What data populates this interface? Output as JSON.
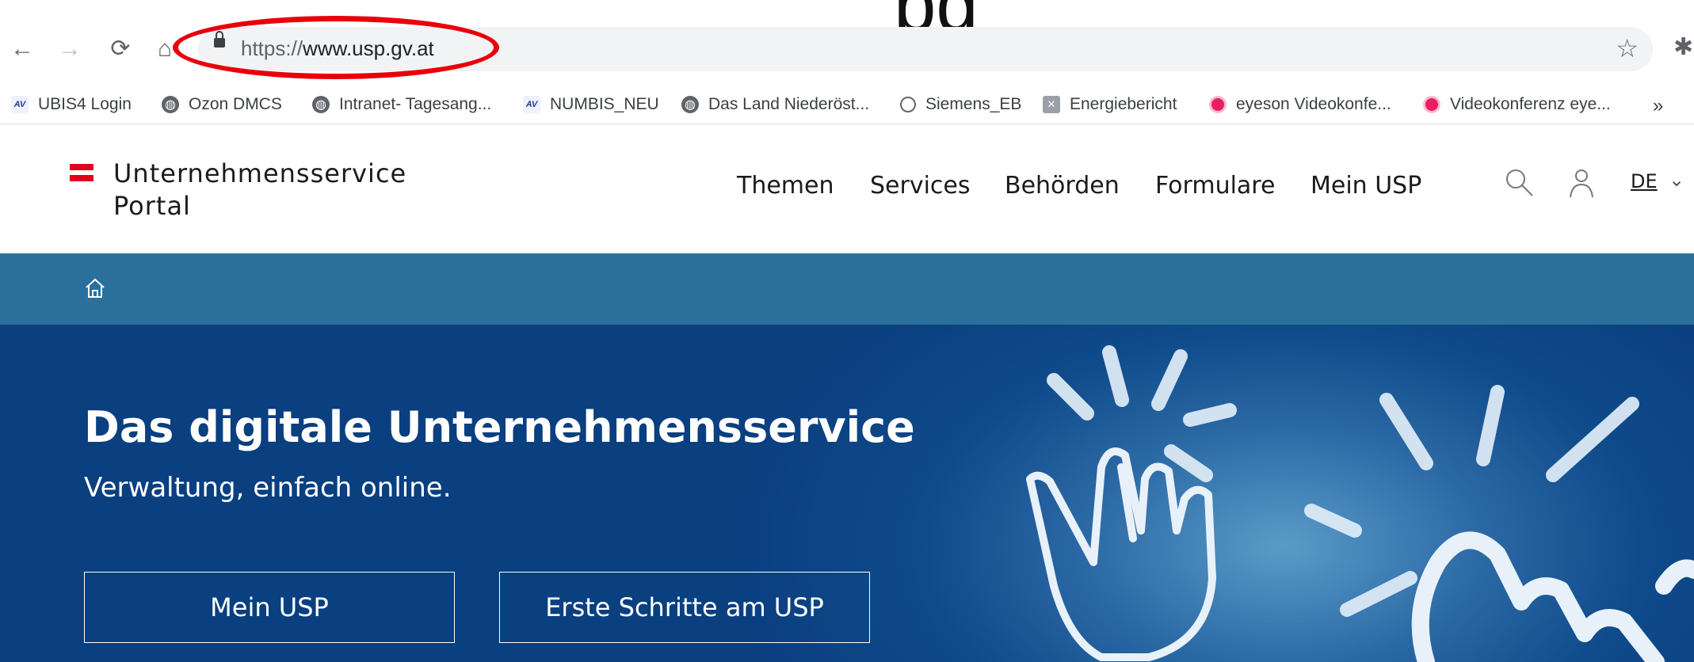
{
  "browser": {
    "url_protocol": "https://",
    "url_host": "www.usp.gv.at",
    "partial_title": "pg",
    "bookmarks": [
      {
        "label": "UBIS4 Login",
        "icon": "ubis-icon"
      },
      {
        "label": "Ozon DMCS",
        "icon": "globe-icon"
      },
      {
        "label": "Intranet- Tagesang...",
        "icon": "globe-icon"
      },
      {
        "label": "NUMBIS_NEU",
        "icon": "ubis-icon"
      },
      {
        "label": "Das Land Niederöst...",
        "icon": "globe-icon"
      },
      {
        "label": "Siemens_EB",
        "icon": "siemens-icon"
      },
      {
        "label": "Energiebericht",
        "icon": "energy-icon"
      },
      {
        "label": "eyeson Videokonfe...",
        "icon": "eyeson-icon"
      },
      {
        "label": "Videokonferenz eye...",
        "icon": "eyeson-icon"
      }
    ],
    "more": "»"
  },
  "site": {
    "logo_line1": "Unternehmensservice",
    "logo_line2": "Portal",
    "nav": [
      "Themen",
      "Services",
      "Behörden",
      "Formulare",
      "Mein USP"
    ],
    "language": "DE",
    "accent_color": "#e3001b",
    "breadcrumb_color": "#2b709c"
  },
  "hero": {
    "title": "Das digitale Unternehmensservice",
    "subtitle": "Verwaltung, einfach online.",
    "buttons": [
      "Mein USP",
      "Erste Schritte am USP"
    ]
  }
}
